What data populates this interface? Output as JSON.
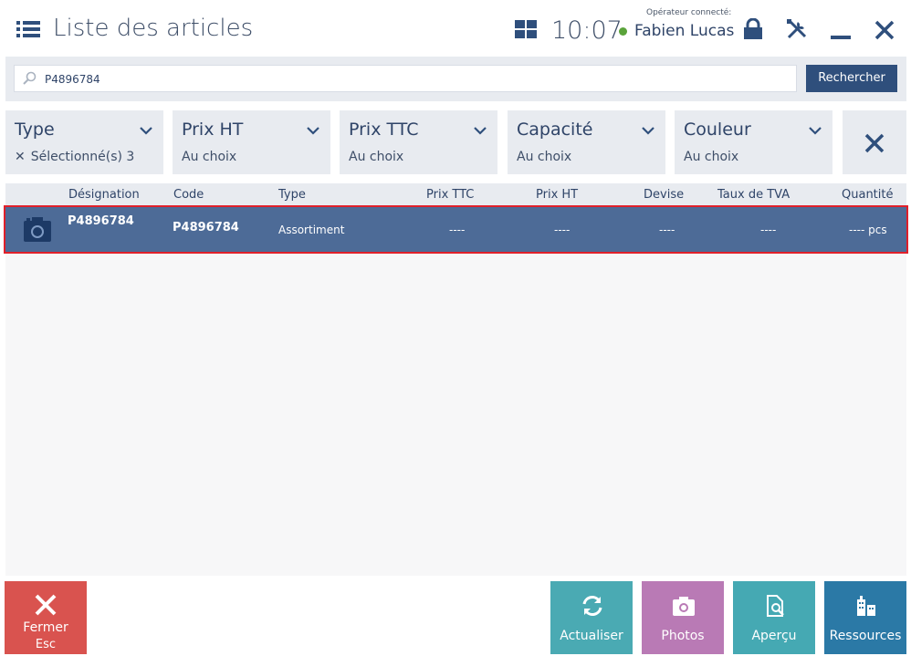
{
  "header": {
    "title": "Liste des articles",
    "time": "10:07",
    "operator_label": "Opérateur connecté:",
    "operator_name": "Fabien Lucas"
  },
  "search": {
    "value": "P4896784",
    "button_label": "Rechercher"
  },
  "filters": [
    {
      "title": "Type",
      "value": "Sélectionné(s) 3"
    },
    {
      "title": "Prix HT",
      "value": "Au choix"
    },
    {
      "title": "Prix TTC",
      "value": "Au choix"
    },
    {
      "title": "Capacité",
      "value": "Au choix"
    },
    {
      "title": "Couleur",
      "value": "Au choix"
    }
  ],
  "table": {
    "columns": [
      "Désignation",
      "Code",
      "Type",
      "Prix TTC",
      "Prix HT",
      "Devise",
      "Taux de TVA",
      "Quantité"
    ],
    "rows": [
      {
        "designation": "P4896784",
        "code": "P4896784",
        "type": "Assortiment",
        "prix_ttc": "----",
        "prix_ht": "----",
        "devise": "----",
        "taux_tva": "----",
        "quantite": "---- pcs"
      }
    ]
  },
  "bottom_bar": {
    "close": {
      "label": "Fermer",
      "shortcut": "Esc"
    },
    "refresh": {
      "label": "Actualiser"
    },
    "photos": {
      "label": "Photos"
    },
    "preview": {
      "label": "Aperçu"
    },
    "resources": {
      "label": "Ressources"
    }
  },
  "colors": {
    "accent": "#2f4f7c",
    "selected_row": "#4d6b97",
    "selected_border": "#e0202a",
    "close_tile": "#d9534f",
    "refresh_tile": "#4aaab3",
    "photos_tile": "#b97ab5",
    "preview_tile": "#45a9b3",
    "resources_tile": "#2b79a6",
    "online": "#5aa33a"
  }
}
